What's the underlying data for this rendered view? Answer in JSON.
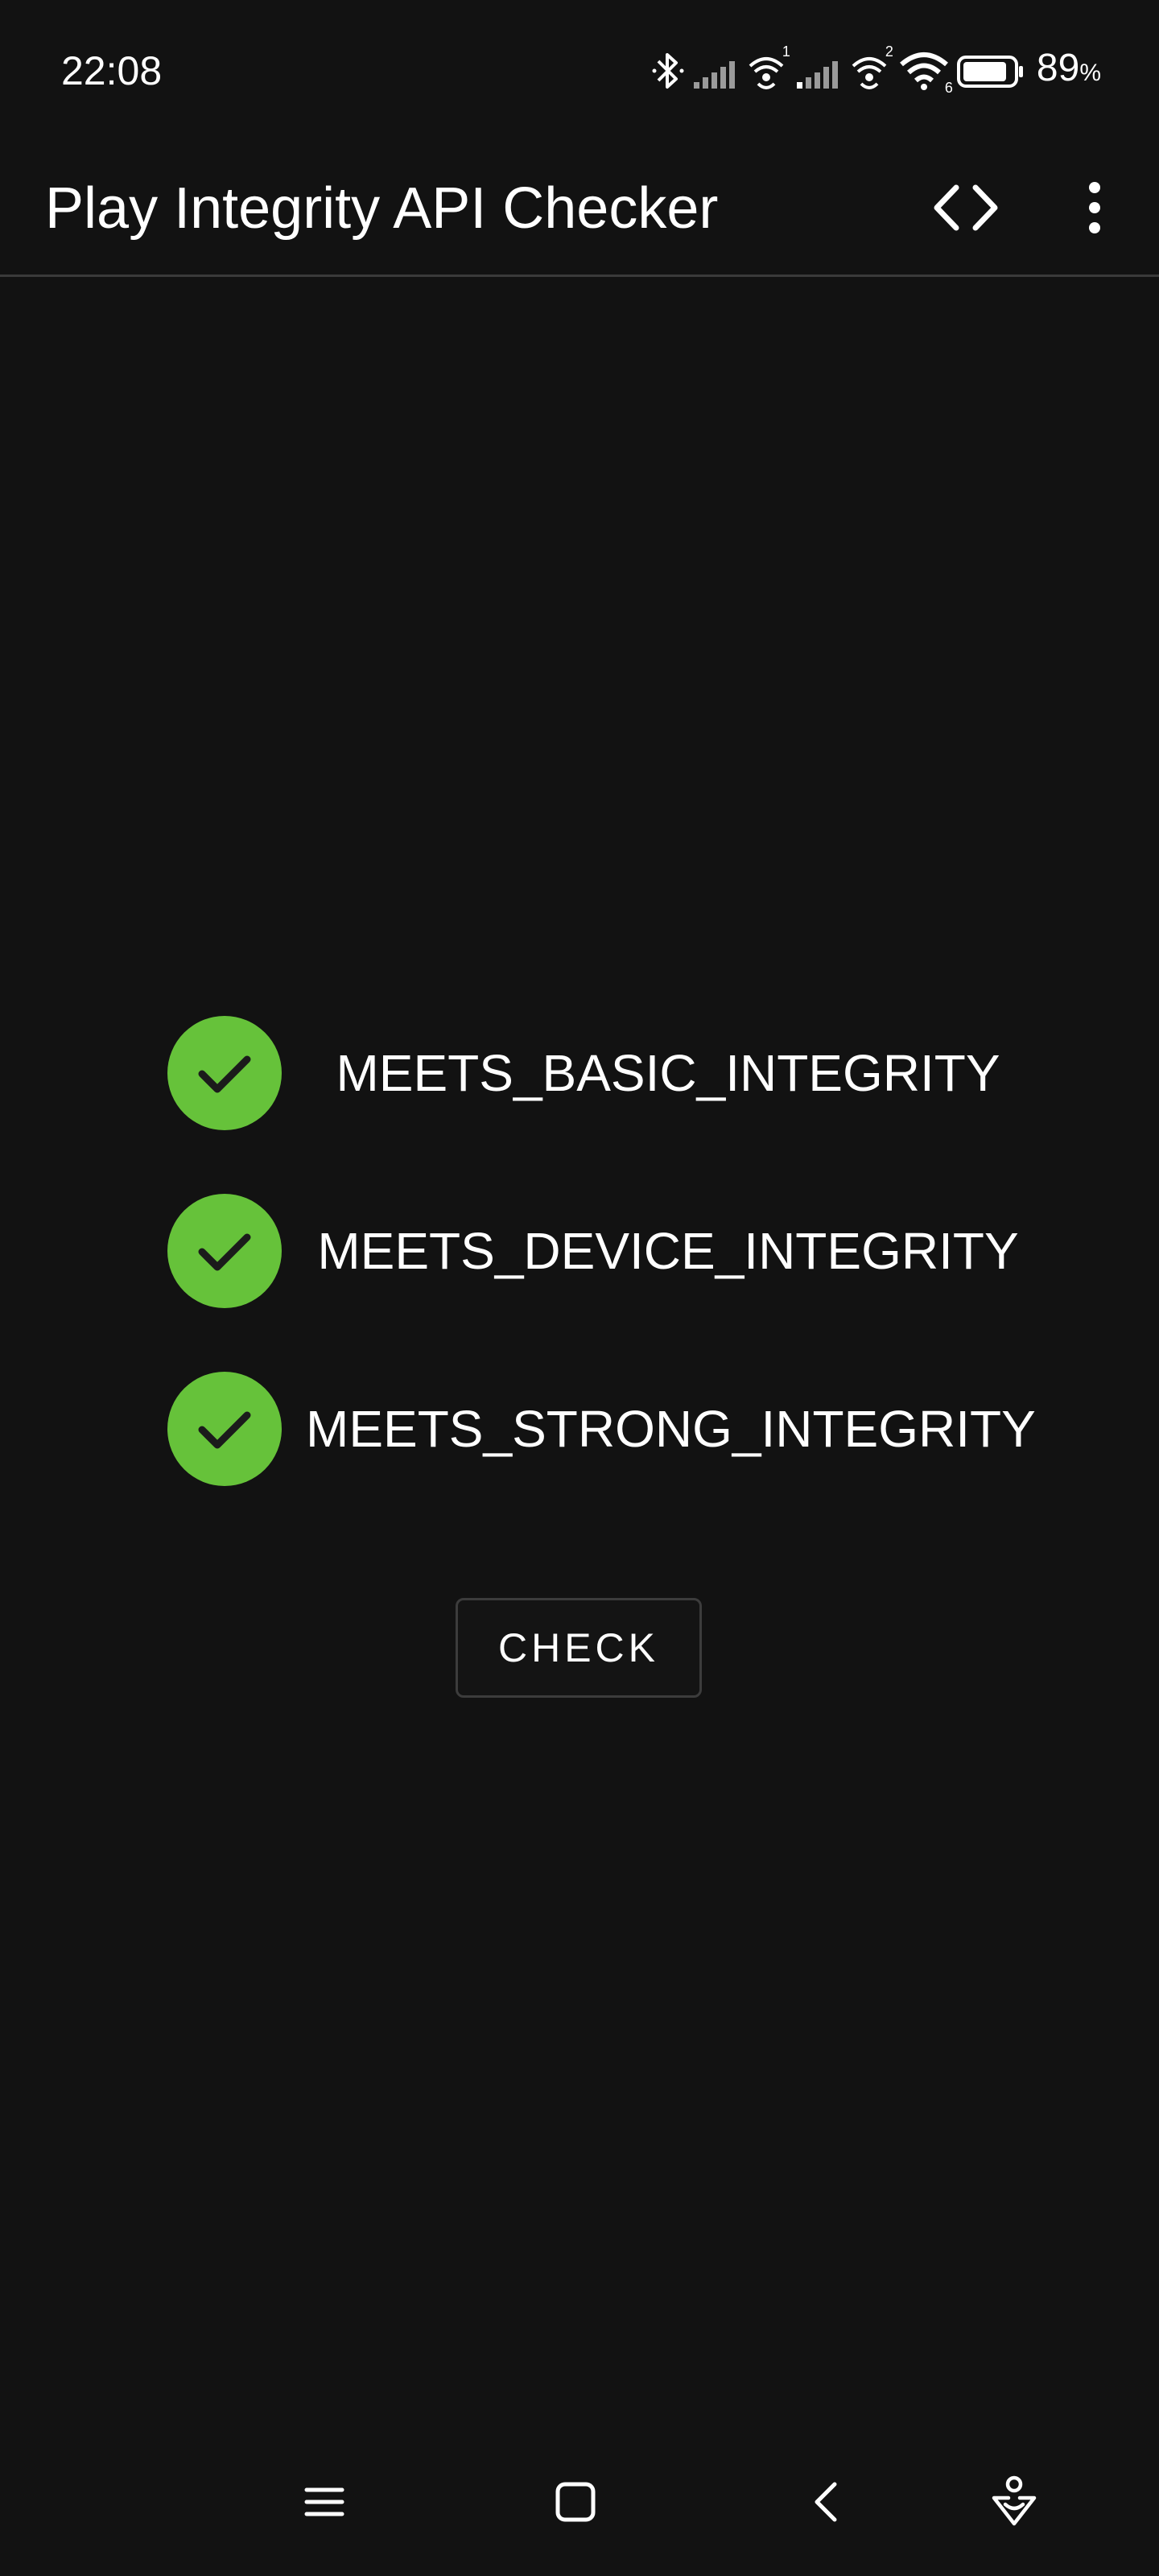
{
  "status_bar": {
    "time": "22:08",
    "battery_percent": "89",
    "battery_percent_sign": "%",
    "battery_level": 0.89,
    "sim1_index": "1",
    "sim2_index": "2",
    "wifi_version": "6",
    "icons": [
      "bluetooth-icon",
      "signal-icon",
      "wifi-calling-icon",
      "signal-icon",
      "wifi-calling-icon",
      "wifi-icon",
      "battery-icon"
    ]
  },
  "app_bar": {
    "title": "Play Integrity API Checker",
    "code_icon": "code-icon",
    "more_icon": "more-vert-icon"
  },
  "integrity_checks": [
    {
      "label": "MEETS_BASIC_INTEGRITY",
      "status": "passed",
      "icon": "check-circle-icon"
    },
    {
      "label": "MEETS_DEVICE_INTEGRITY",
      "status": "passed",
      "icon": "check-circle-icon"
    },
    {
      "label": "MEETS_STRONG_INTEGRITY",
      "status": "passed",
      "icon": "check-circle-icon"
    }
  ],
  "check_button": {
    "label": "CHECK"
  },
  "nav_bar": {
    "icons": [
      "menu-icon",
      "home-icon",
      "back-icon",
      "assistant-icon"
    ]
  },
  "colors": {
    "background": "#121212",
    "pass_green": "#66c23a",
    "text": "#ffffff",
    "divider": "#3a3a3a"
  }
}
